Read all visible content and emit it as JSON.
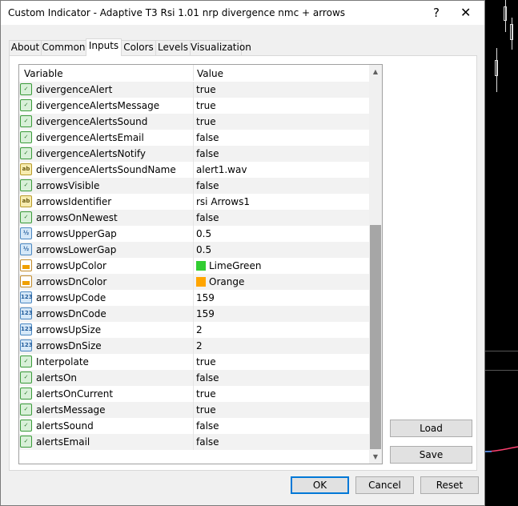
{
  "window": {
    "title": "Custom Indicator - Adaptive T3 Rsi 1.01 nrp divergence nmc + arrows",
    "help_label": "?",
    "close_label": "✕"
  },
  "tabs": [
    {
      "label": "About"
    },
    {
      "label": "Common"
    },
    {
      "label": "Inputs",
      "active": true
    },
    {
      "label": "Colors"
    },
    {
      "label": "Levels"
    },
    {
      "label": "Visualization"
    }
  ],
  "grid": {
    "columns": [
      "Variable",
      "Value"
    ],
    "rows": [
      {
        "variable": "divergenceAlert",
        "value": "true",
        "type": "bool"
      },
      {
        "variable": "divergenceAlertsMessage",
        "value": "true",
        "type": "bool"
      },
      {
        "variable": "divergenceAlertsSound",
        "value": "true",
        "type": "bool"
      },
      {
        "variable": "divergenceAlertsEmail",
        "value": "false",
        "type": "bool"
      },
      {
        "variable": "divergenceAlertsNotify",
        "value": "false",
        "type": "bool"
      },
      {
        "variable": "divergenceAlertsSoundName",
        "value": "alert1.wav",
        "type": "string"
      },
      {
        "variable": "arrowsVisible",
        "value": "false",
        "type": "bool"
      },
      {
        "variable": "arrowsIdentifier",
        "value": "rsi Arrows1",
        "type": "string"
      },
      {
        "variable": "arrowsOnNewest",
        "value": "false",
        "type": "bool"
      },
      {
        "variable": "arrowsUpperGap",
        "value": "0.5",
        "type": "double"
      },
      {
        "variable": "arrowsLowerGap",
        "value": "0.5",
        "type": "double"
      },
      {
        "variable": "arrowsUpColor",
        "value": "LimeGreen",
        "type": "color",
        "swatch": "#32cd32"
      },
      {
        "variable": "arrowsDnColor",
        "value": "Orange",
        "type": "color",
        "swatch": "#ffa500"
      },
      {
        "variable": "arrowsUpCode",
        "value": "159",
        "type": "int"
      },
      {
        "variable": "arrowsDnCode",
        "value": "159",
        "type": "int"
      },
      {
        "variable": "arrowsUpSize",
        "value": "2",
        "type": "int"
      },
      {
        "variable": "arrowsDnSize",
        "value": "2",
        "type": "int"
      },
      {
        "variable": "Interpolate",
        "value": "true",
        "type": "bool"
      },
      {
        "variable": "alertsOn",
        "value": "false",
        "type": "bool"
      },
      {
        "variable": "alertsOnCurrent",
        "value": "true",
        "type": "bool"
      },
      {
        "variable": "alertsMessage",
        "value": "true",
        "type": "bool"
      },
      {
        "variable": "alertsSound",
        "value": "false",
        "type": "bool"
      },
      {
        "variable": "alertsEmail",
        "value": "false",
        "type": "bool"
      }
    ]
  },
  "side_buttons": {
    "load": "Load",
    "save": "Save"
  },
  "footer": {
    "ok": "OK",
    "cancel": "Cancel",
    "reset": "Reset"
  },
  "colors": {
    "accent": "#0078d7",
    "scroll_thumb": "#a6a6a6"
  }
}
